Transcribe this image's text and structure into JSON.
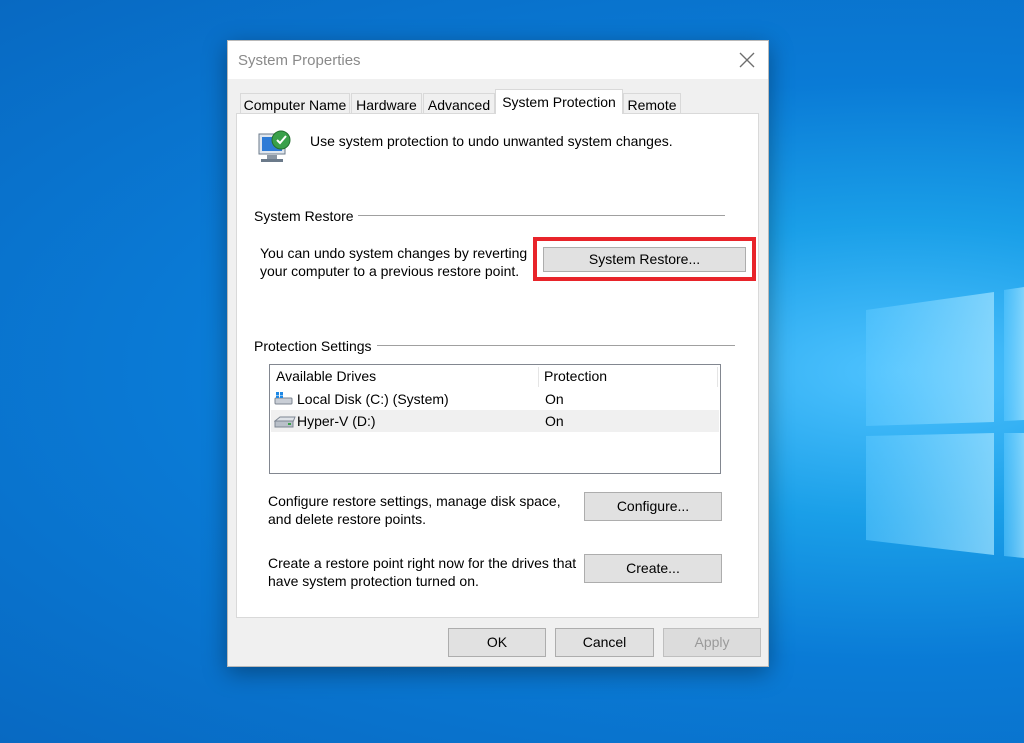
{
  "dialog": {
    "title": "System Properties",
    "tabs": [
      {
        "label": "Computer Name"
      },
      {
        "label": "Hardware"
      },
      {
        "label": "Advanced"
      },
      {
        "label": "System Protection",
        "active": true
      },
      {
        "label": "Remote"
      }
    ],
    "intro_text": "Use system protection to undo unwanted system changes.",
    "system_restore": {
      "group_label": "System Restore",
      "description_line1": "You can undo system changes by reverting",
      "description_line2": "your computer to a previous restore point.",
      "button_label": "System Restore..."
    },
    "protection_settings": {
      "group_label": "Protection Settings",
      "columns": [
        "Available Drives",
        "Protection"
      ],
      "drives": [
        {
          "name": "Local Disk (C:) (System)",
          "protection": "On",
          "icon": "system-drive-icon"
        },
        {
          "name": "Hyper-V (D:)",
          "protection": "On",
          "icon": "drive-icon"
        }
      ],
      "configure_text_line1": "Configure restore settings, manage disk space,",
      "configure_text_line2": "and delete restore points.",
      "configure_button": "Configure...",
      "create_text_line1": "Create a restore point right now for the drives that",
      "create_text_line2": "have system protection turned on.",
      "create_button": "Create..."
    },
    "footer": {
      "ok": "OK",
      "cancel": "Cancel",
      "apply": "Apply"
    }
  },
  "colors": {
    "highlight": "#e8242a",
    "desktop": "#0a7bd6"
  }
}
